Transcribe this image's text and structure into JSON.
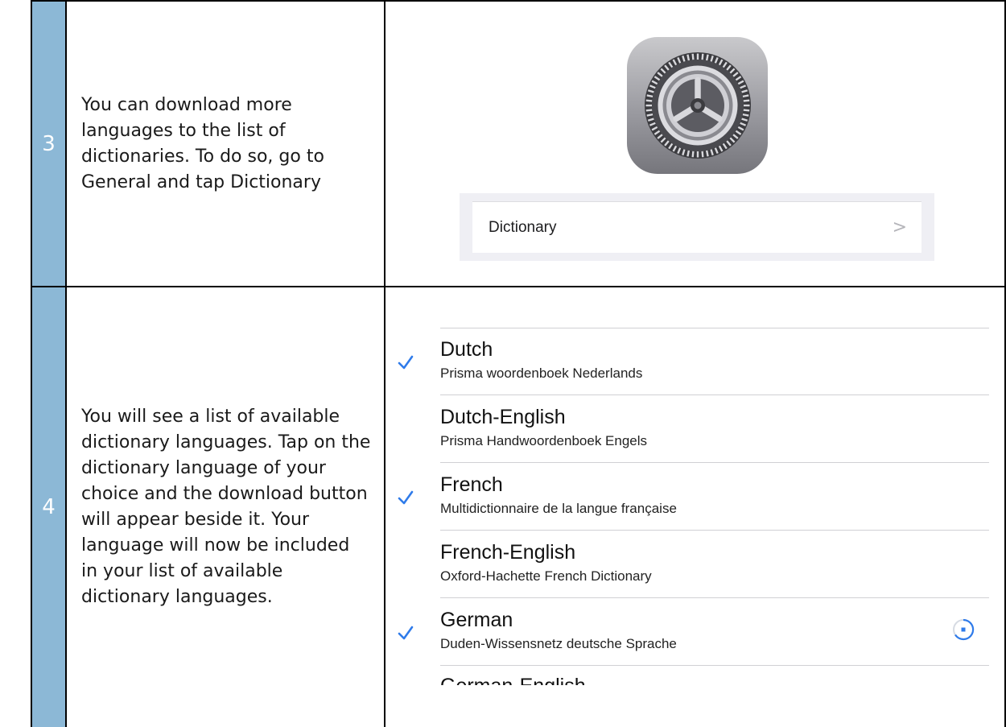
{
  "rows": [
    {
      "number": "3",
      "instruction": "You can download more languages to the list of dictionaries. To do so, go to General and tap Dictionary",
      "settings_item": {
        "label": "Dictionary",
        "chevron": ">"
      },
      "icon": "settings-gear-icon"
    },
    {
      "number": "4",
      "instruction": "You will see a list of available dictionary languages. Tap on the dictionary language of your choice and the download button will appear beside it. Your language will now be included in your list of available dictionary languages.",
      "dictionaries": [
        {
          "title": "Dutch",
          "subtitle": "Prisma woordenboek Nederlands",
          "checked": true
        },
        {
          "title": "Dutch-English",
          "subtitle": "Prisma Handwoordenboek Engels",
          "checked": false
        },
        {
          "title": "French",
          "subtitle": "Multidictionnaire de la langue française",
          "checked": true
        },
        {
          "title": "French-English",
          "subtitle": "Oxford-Hachette French Dictionary",
          "checked": false
        },
        {
          "title": "German",
          "subtitle": "Duden-Wissensnetz deutsche Sprache",
          "checked": true,
          "downloading": true
        }
      ],
      "partial_item": "German-English"
    }
  ],
  "colors": {
    "number_column": "#8cb8d6",
    "checkmark": "#2f7bea",
    "spinner": "#2f7bea"
  }
}
